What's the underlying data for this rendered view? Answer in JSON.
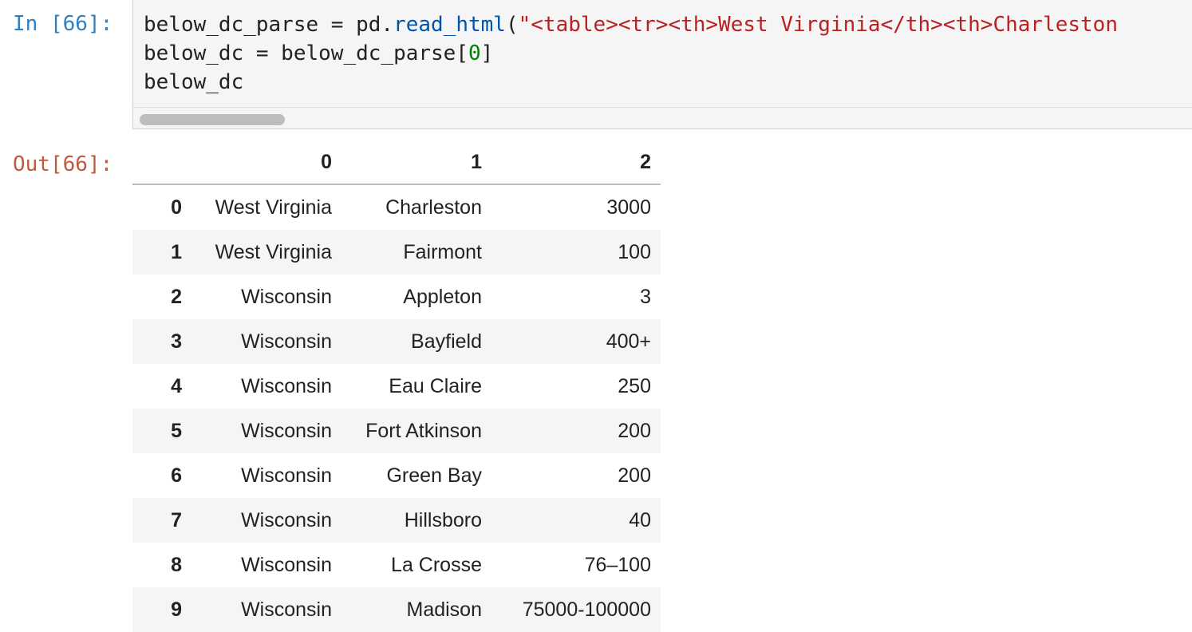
{
  "input_prompt": "In [66]:",
  "output_prompt": "Out[66]:",
  "code": {
    "line1": {
      "var": "below_dc_parse = pd.",
      "fn": "read_html",
      "paren": "(",
      "str": "\"<table><tr><th>West Virginia</th><th>Charleston"
    },
    "line2": {
      "pre": "below_dc = below_dc_parse[",
      "num": "0",
      "post": "]"
    },
    "line3": "below_dc"
  },
  "table": {
    "columns": [
      "",
      "0",
      "1",
      "2"
    ],
    "rows": [
      {
        "index": "0",
        "c0": "West Virginia",
        "c1": "Charleston",
        "c2": "3000"
      },
      {
        "index": "1",
        "c0": "West Virginia",
        "c1": "Fairmont",
        "c2": "100"
      },
      {
        "index": "2",
        "c0": "Wisconsin",
        "c1": "Appleton",
        "c2": "3"
      },
      {
        "index": "3",
        "c0": "Wisconsin",
        "c1": "Bayfield",
        "c2": "400+"
      },
      {
        "index": "4",
        "c0": "Wisconsin",
        "c1": "Eau Claire",
        "c2": "250"
      },
      {
        "index": "5",
        "c0": "Wisconsin",
        "c1": "Fort Atkinson",
        "c2": "200"
      },
      {
        "index": "6",
        "c0": "Wisconsin",
        "c1": "Green Bay",
        "c2": "200"
      },
      {
        "index": "7",
        "c0": "Wisconsin",
        "c1": "Hillsboro",
        "c2": "40"
      },
      {
        "index": "8",
        "c0": "Wisconsin",
        "c1": "La Crosse",
        "c2": "76–100"
      },
      {
        "index": "9",
        "c0": "Wisconsin",
        "c1": "Madison",
        "c2": "75000-100000"
      }
    ]
  },
  "colors": {
    "prompt_in": "#307fc1",
    "prompt_out": "#bf5b3d",
    "code_bg": "#f5f5f5",
    "string": "#ba2121",
    "function": "#0055aa",
    "number": "#008000"
  }
}
